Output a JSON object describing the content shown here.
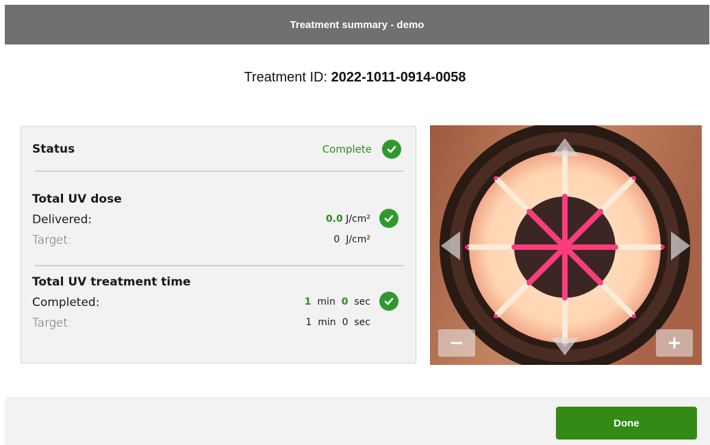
{
  "window": {
    "title": "Treatment summary - demo"
  },
  "treatment": {
    "id_label": "Treatment ID:",
    "id_value": "2022-1011-0914-0058"
  },
  "status": {
    "label": "Status",
    "value": "Complete"
  },
  "uv_dose": {
    "heading": "Total UV dose",
    "delivered_label": "Delivered:",
    "delivered_value": "0.0",
    "delivered_unit": "J/cm²",
    "target_label": "Target:",
    "target_value": "0",
    "target_unit": "J/cm²"
  },
  "uv_time": {
    "heading": "Total UV treatment time",
    "completed_label": "Completed:",
    "completed_min": "1",
    "completed_sec": "0",
    "target_label": "Target:",
    "target_min": "1",
    "target_sec": "0",
    "min_unit": "min",
    "sec_unit": "sec"
  },
  "camera": {
    "zoom_out_label": "−",
    "zoom_in_label": "+",
    "icons": [
      "arrow-up-icon",
      "arrow-down-icon",
      "arrow-left-icon",
      "arrow-right-icon"
    ]
  },
  "footer": {
    "done_label": "Done"
  },
  "colors": {
    "accent": "#338a17",
    "check": "#2e9a2c",
    "titlebar": "#6f706f"
  }
}
